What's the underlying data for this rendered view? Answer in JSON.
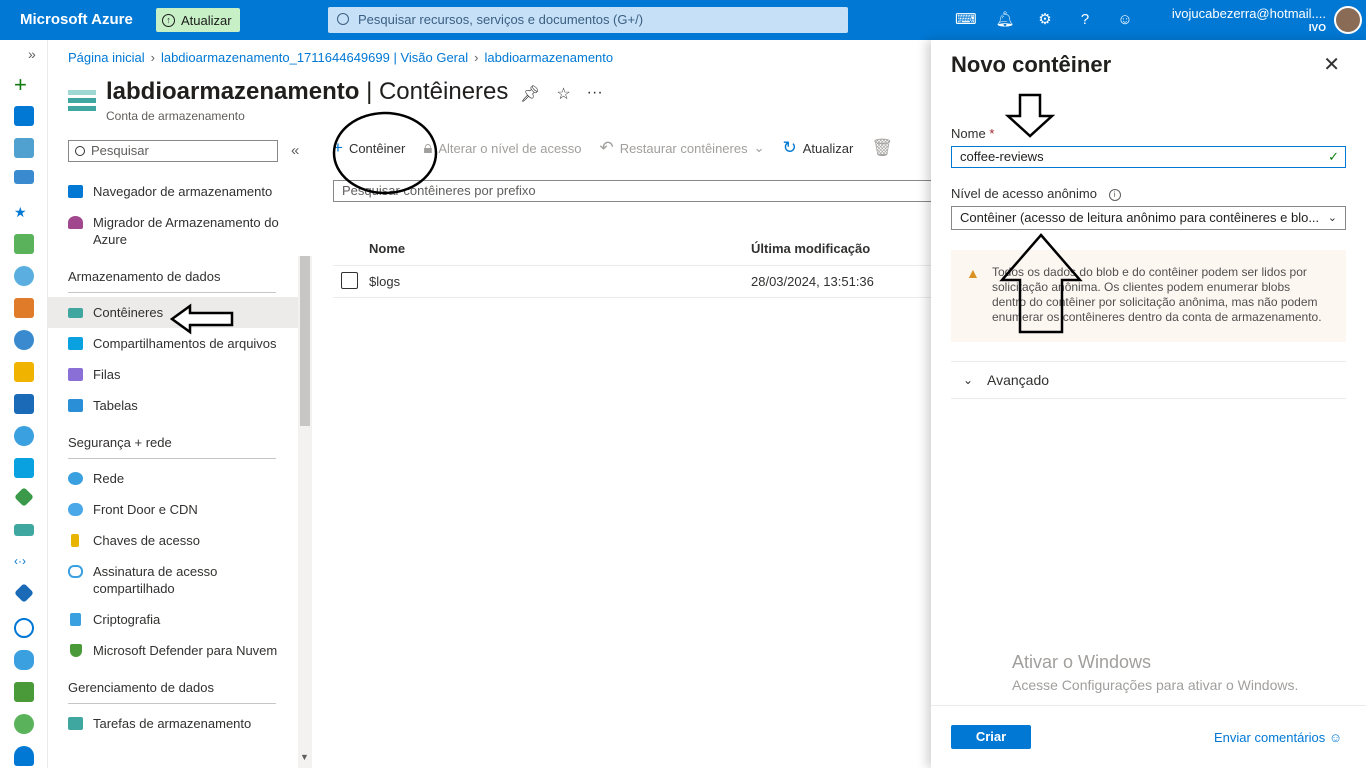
{
  "topbar": {
    "brand": "Microsoft Azure",
    "upgrade_label": "Atualizar",
    "search_placeholder": "Pesquisar recursos, serviços e documentos (G+/)",
    "user_email": "ivojucabezerra@hotmail....",
    "user_org": "IVO",
    "icons": [
      "cloud-shell-icon",
      "bell-icon",
      "gear-icon",
      "help-icon",
      "feedback-icon"
    ]
  },
  "breadcrumb": {
    "items": [
      "Página inicial",
      "labdioarmazenamento_1711644649699 | Visão Geral",
      "labdioarmazenamento"
    ]
  },
  "header": {
    "resource_name": "labdioarmazenamento",
    "page_name": " | Contêineres",
    "subtitle": "Conta de armazenamento"
  },
  "menu": {
    "search_placeholder": "Pesquisar",
    "items_top": [
      {
        "label": "Navegador de armazenamento",
        "color": "#0078d4"
      },
      {
        "label": "Migrador de Armazenamento do Azure",
        "color": "#a0478d"
      }
    ],
    "section_data": "Armazenamento de dados",
    "items_data": [
      {
        "label": "Contêineres",
        "color": "#3fa7a0"
      },
      {
        "label": "Compartilhamentos de arquivos",
        "color": "#0aa1e0"
      },
      {
        "label": "Filas",
        "color": "#8a6fd6"
      },
      {
        "label": "Tabelas",
        "color": "#2a8fd6"
      }
    ],
    "section_security": "Segurança + rede",
    "items_security": [
      {
        "label": "Rede",
        "color": "#3aa0e0"
      },
      {
        "label": "Front Door e CDN",
        "color": "#4aa8e8"
      },
      {
        "label": "Chaves de acesso",
        "color": "#e8b400"
      },
      {
        "label": "Assinatura de acesso compartilhado",
        "color": "#3aa0e0"
      },
      {
        "label": "Criptografia",
        "color": "#3aa0e0"
      },
      {
        "label": "Microsoft Defender para Nuvem",
        "color": "#4a9a3a"
      }
    ],
    "section_management": "Gerenciamento de dados",
    "items_management": [
      {
        "label": "Tarefas de armazenamento",
        "color": "#3fa7a0"
      }
    ]
  },
  "commands": {
    "add_container": "Contêiner",
    "change_access": "Alterar o nível de acesso",
    "restore": "Restaurar contêineres",
    "refresh": "Atualizar"
  },
  "filter_placeholder": "Pesquisar contêineres por prefixo",
  "table": {
    "col_name": "Nome",
    "col_modified": "Última modificação",
    "rows": [
      {
        "name": "$logs",
        "modified": "28/03/2024, 13:51:36"
      }
    ]
  },
  "panel": {
    "title": "Novo contêiner",
    "name_label": "Nome",
    "required_mark": "*",
    "name_value": "coffee-reviews",
    "access_label": "Nível de acesso anônimo",
    "access_value": "Contêiner (acesso de leitura anônimo para contêineres e blo...",
    "warning": "Todos os dados do blob e do contêiner podem ser lidos por solicitação anônima. Os clientes podem enumerar blobs dentro do contêiner por solicitação anônima, mas não podem enumerar os contêineres dentro da conta de armazenamento.",
    "advanced_label": "Avançado",
    "watermark_title": "Ativar o Windows",
    "watermark_sub": "Acesse Configurações para ativar o Windows.",
    "create_label": "Criar",
    "feedback_label": "Enviar comentários"
  }
}
